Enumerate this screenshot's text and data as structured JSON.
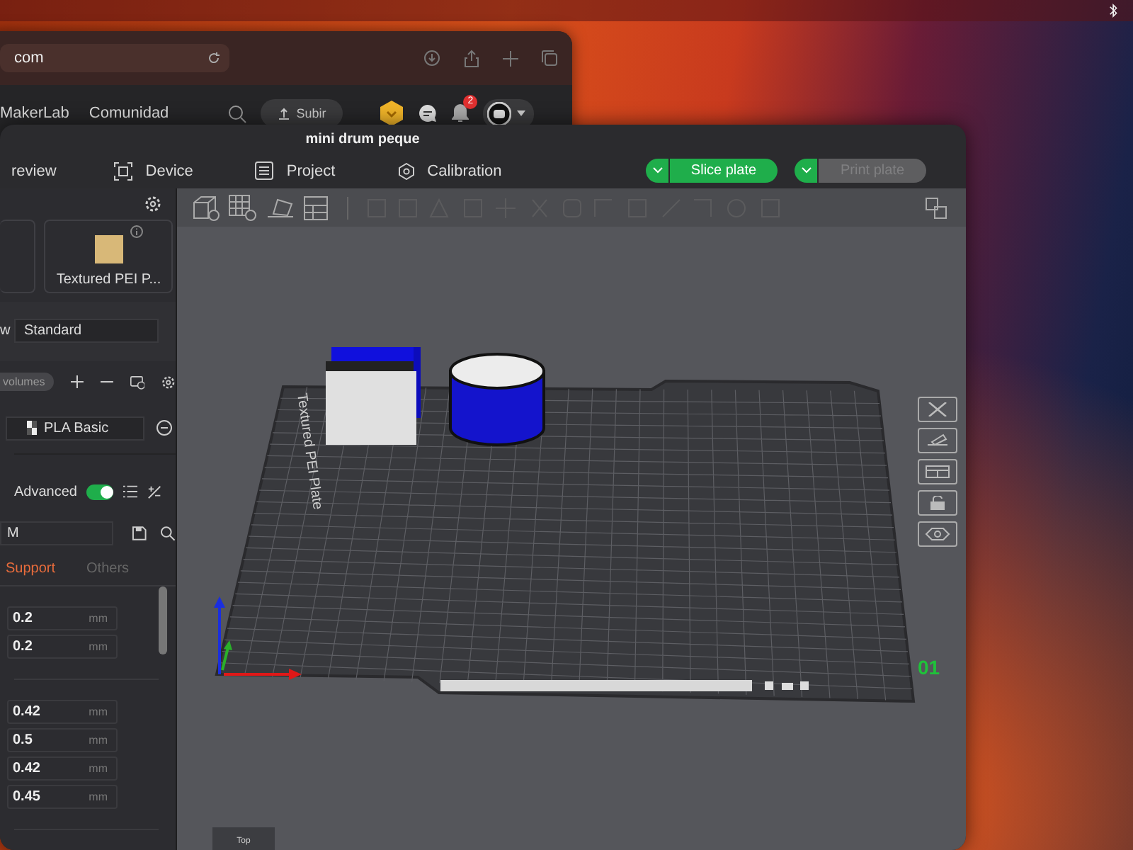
{
  "browser": {
    "address": "com",
    "nav_links": [
      "MakerLab",
      "Comunidad"
    ],
    "upload_button": "Subir",
    "notification_count": "2"
  },
  "slicer": {
    "title": "mini drum peque",
    "tabs": [
      {
        "label": "review",
        "selected": false
      },
      {
        "label": "Device",
        "selected": false
      },
      {
        "label": "Project",
        "selected": false
      },
      {
        "label": "Calibration",
        "selected": false
      }
    ],
    "actions": [
      {
        "label": "Slice plate",
        "disabled": false
      },
      {
        "label": "Print plate",
        "disabled": true
      }
    ]
  },
  "sidebar": {
    "plate_type": "Textured PEI P...",
    "process_label": "w",
    "process_preset": "Standard",
    "objects_pill": "volumes",
    "filament": "PLA Basic",
    "advanced": {
      "label": "Advanced",
      "on": true
    },
    "preset_field": "M",
    "setting_tabs": [
      {
        "label": "Support",
        "selected": true
      },
      {
        "label": "Others",
        "selected": false
      }
    ],
    "setting_groups": [
      {
        "rows": [
          {
            "value": "0.2",
            "unit": "mm"
          },
          {
            "value": "0.2",
            "unit": "mm"
          }
        ]
      },
      {
        "rows": [
          {
            "value": "0.42",
            "unit": "mm"
          },
          {
            "value": "0.5",
            "unit": "mm"
          },
          {
            "value": "0.42",
            "unit": "mm"
          },
          {
            "value": "0.45",
            "unit": "mm"
          }
        ]
      }
    ]
  },
  "viewport": {
    "plate_label": "Textured PEI Plate",
    "plate_number": "01",
    "view_label": "Top"
  }
}
